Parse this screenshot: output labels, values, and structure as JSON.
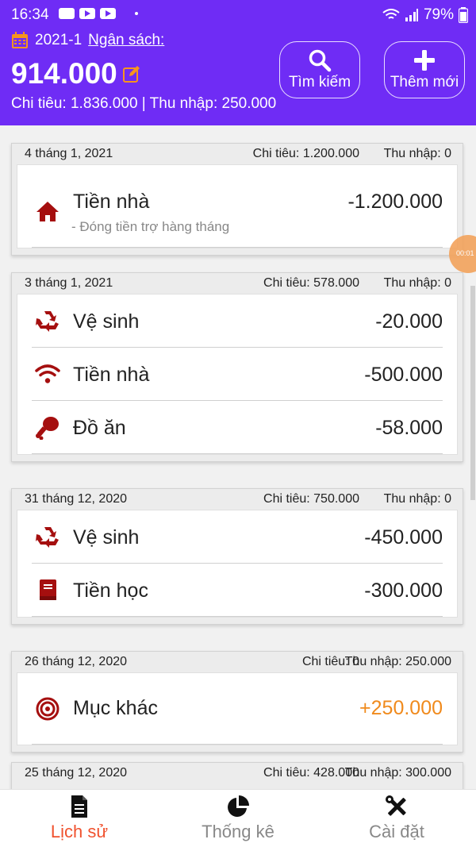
{
  "status_bar": {
    "time": "16:34",
    "battery": "79%"
  },
  "header": {
    "period": "2021-1",
    "budget_label": "Ngân sách:",
    "budget_amount": "914.000",
    "totals_text": "Chi tiêu: 1.836.000  |  Thu nhập: 250.000",
    "search_label": "Tìm kiếm",
    "add_label": "Thêm mới",
    "accent": "#6f2cf5"
  },
  "days": [
    {
      "date": "4 tháng 1, 2021",
      "spend": "Chi tiêu: 1.200.000",
      "income": "Thu nhập: 0",
      "items": [
        {
          "icon": "house-icon",
          "name": "Tiền nhà",
          "note": "- Đóng tiền trợ hàng tháng",
          "value": "-1.200.000"
        }
      ]
    },
    {
      "date": "3 tháng 1, 2021",
      "spend": "Chi tiêu: 578.000",
      "income": "Thu nhập: 0",
      "items": [
        {
          "icon": "recycle-icon",
          "name": "Vệ sinh",
          "value": "-20.000"
        },
        {
          "icon": "wifi-icon",
          "name": "Tiền nhà",
          "value": "-500.000"
        },
        {
          "icon": "drumstick-icon",
          "name": "Đồ ăn",
          "value": "-58.000"
        }
      ]
    },
    {
      "date": "31 tháng 12, 2020",
      "spend": "Chi tiêu: 750.000",
      "income": "Thu nhập: 0",
      "items": [
        {
          "icon": "recycle-icon",
          "name": "Vệ sinh",
          "value": "-450.000"
        },
        {
          "icon": "book-icon",
          "name": "Tiền học",
          "value": "-300.000"
        }
      ]
    },
    {
      "date": "26 tháng 12, 2020",
      "spend": "Chi tiêu: 0",
      "income": "Thu nhập: 250.000",
      "items": [
        {
          "icon": "target-icon",
          "name": "Mục khác",
          "value": "+250.000"
        }
      ]
    },
    {
      "date": "25 tháng 12, 2020",
      "spend": "Chi tiêu: 428.000",
      "income": "Thu nhập: 300.000",
      "items": []
    }
  ],
  "recording_badge": "00:01",
  "nav": {
    "history": "Lịch sử",
    "stats": "Thống kê",
    "settings": "Cài đặt"
  },
  "colors": {
    "icon_red": "#a50f0f",
    "positive": "#f08a1c",
    "active_nav": "#f0522f"
  }
}
